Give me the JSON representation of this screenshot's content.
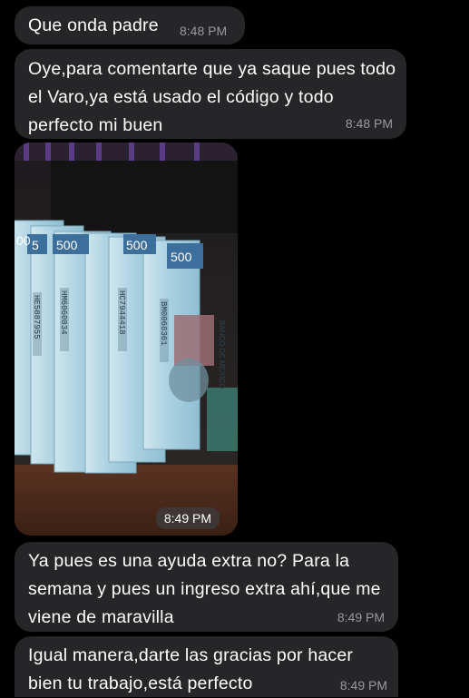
{
  "messages": [
    {
      "text": "Que onda padre",
      "time": "8:48 PM"
    },
    {
      "text": "Oye,para comentarte que ya saque pues todo el Varo,ya está usado el código y todo perfecto mi buen",
      "time": "8:48 PM"
    },
    {
      "type": "image",
      "time": "8:49 PM"
    },
    {
      "text": "Ya pues es una ayuda extra no? Para la semana y pues un ingreso extra ahí,que me viene de maravilla",
      "time": "8:49 PM"
    },
    {
      "text": "Igual manera,darte las gracias por hacer bien tu trabajo,está perfecto",
      "time": "8:49 PM"
    }
  ],
  "photo": {
    "denomination": "500",
    "bank": "BANCO DE MÉXICO",
    "serials": [
      "HE5087955",
      "HM6060834",
      "HC7944418",
      "BM0068361"
    ]
  },
  "colors": {
    "background": "#000000",
    "bubble": "#262628",
    "timestamp": "#9a9a9e",
    "banknote": "#a9cddd"
  }
}
